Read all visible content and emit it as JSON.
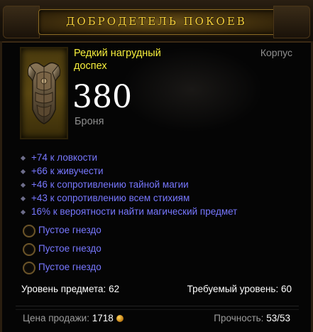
{
  "title": "ДОБРОДЕТЕЛЬ ПОКОЕВ",
  "item": {
    "name": "Редкий нагрудный доспех",
    "slot": "Корпус",
    "armor_value": "380",
    "armor_label": "Броня",
    "icon": "chest-armor-icon"
  },
  "affixes": [
    "+74 к ловкости",
    "+66 к живучести",
    "+46 к сопротивлению тайной магии",
    "+43 к сопротивлению всем стихиям",
    "16% к вероятности найти магический предмет"
  ],
  "sockets": [
    "Пустое гнездо",
    "Пустое гнездо",
    "Пустое гнездо"
  ],
  "item_level": {
    "label": "Уровень предмета:",
    "value": "62"
  },
  "required_level": {
    "label": "Требуемый уровень:",
    "value": "60"
  },
  "sell_price": {
    "label": "Цена продажи:",
    "value": "1718",
    "icon": "gold-coin-icon"
  },
  "durability": {
    "label": "Прочность:",
    "value": "53/53"
  },
  "colors": {
    "title": "#f3cd3a",
    "rare_name": "#f7ef3c",
    "affix": "#7777ff",
    "label_gray": "#8f8f8f",
    "value_white": "#ffffff"
  }
}
